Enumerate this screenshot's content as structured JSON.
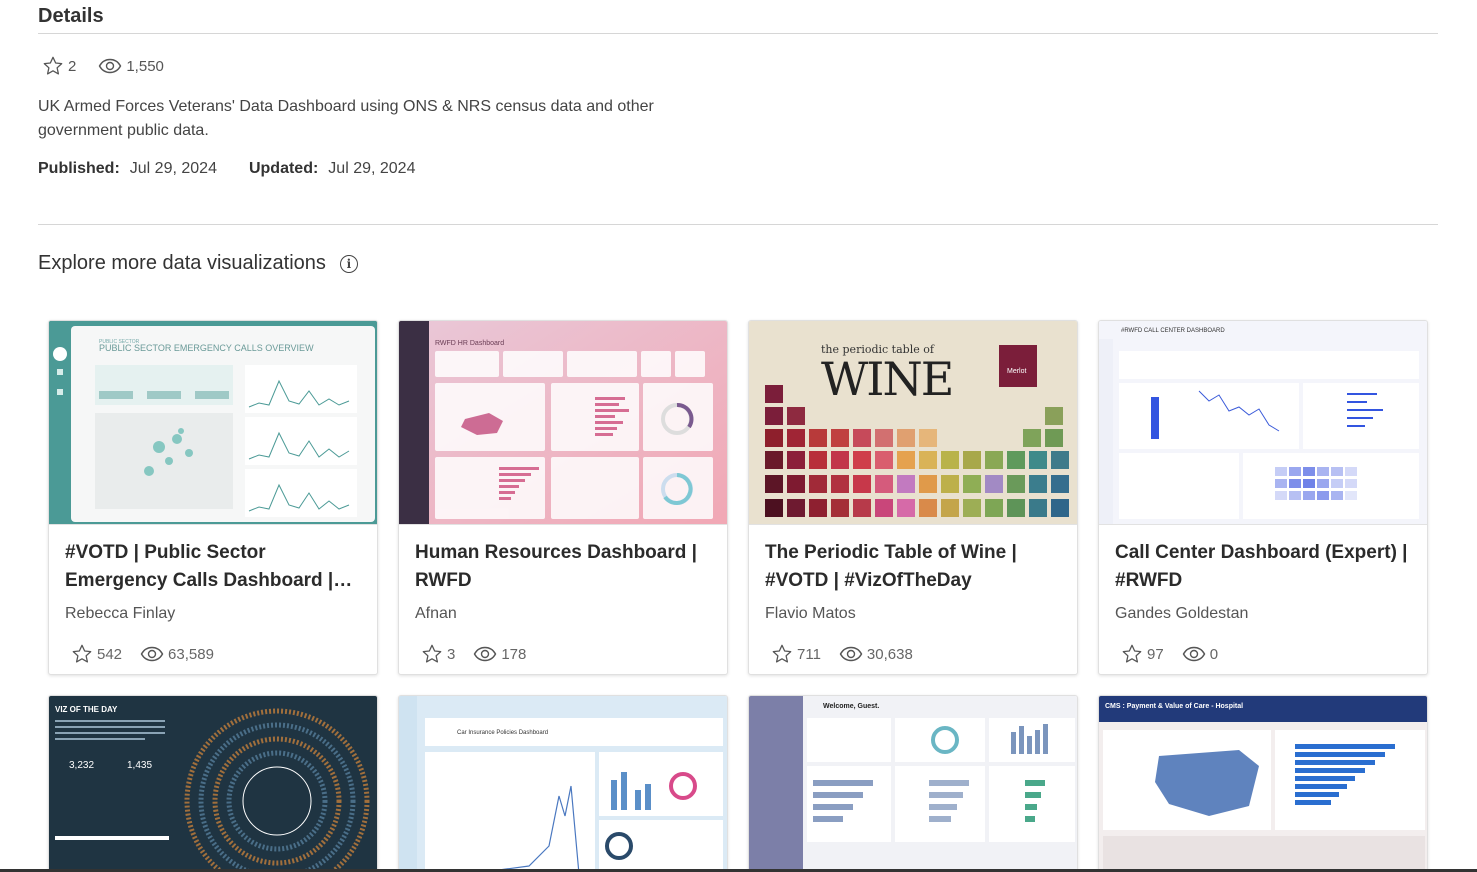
{
  "details": {
    "title": "Details",
    "favorites": "2",
    "views": "1,550",
    "description": "UK Armed Forces Veterans' Data Dashboard using ONS & NRS census data and other government public data.",
    "published_label": "Published:",
    "published_value": "Jul 29, 2024",
    "updated_label": "Updated:",
    "updated_value": "Jul 29, 2024"
  },
  "explore": {
    "title": "Explore more data visualizations",
    "info_icon": "info-icon"
  },
  "cards": [
    {
      "title": "#VOTD | Public Sector Emergency Calls Dashboard | #RWFD",
      "author": "Rebecca Finlay",
      "favorites": "542",
      "views": "63,589"
    },
    {
      "title": "Human Resources Dashboard | RWFD",
      "author": "Afnan",
      "favorites": "3",
      "views": "178"
    },
    {
      "title": "The Periodic Table of Wine | #VOTD | #VizOfTheDay",
      "author": "Flavio Matos",
      "favorites": "711",
      "views": "30,638"
    },
    {
      "title": "Call Center Dashboard (Expert) | #RWFD",
      "author": "Gandes Goldestan",
      "favorites": "97",
      "views": "0"
    }
  ],
  "thumb_text": {
    "t1": "PUBLIC SECTOR EMERGENCY CALLS OVERVIEW",
    "t2": "RWFD HR Dashboard",
    "t3a": "the periodic table of",
    "t3b": "WINE",
    "t3c": "Merlot",
    "t4": "#RWFD CALL CENTER DASHBOARD",
    "t5": "VIZ OF THE DAY",
    "t5b": "3,232",
    "t5c": "1,435",
    "t6": "Car Insurance Policies Dashboard",
    "t7": "Welcome, Guest.",
    "t8": "CMS : Payment & Value of Care - Hospital"
  },
  "colors": {
    "accent": "#333333",
    "wine": "#7b1e3a",
    "teal": "#4a9e9a"
  }
}
